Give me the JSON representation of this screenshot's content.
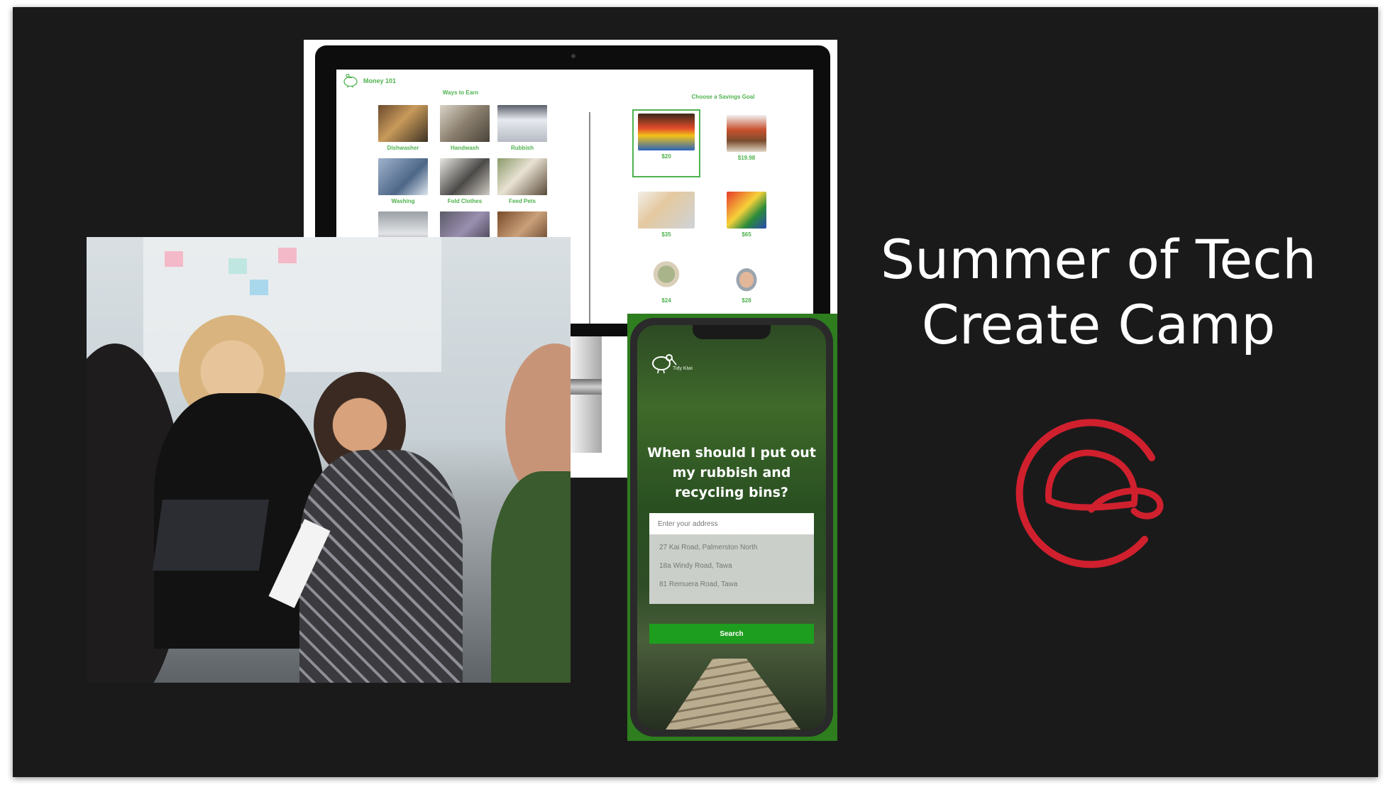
{
  "slide": {
    "title_line1": "Summer of Tech",
    "title_line2": "Create Camp",
    "logo_icon": "cap-circle-logo",
    "logo_color": "#d0202e",
    "background_color": "#1b1a1a"
  },
  "money_app": {
    "app_name": "Money 101",
    "earn_section_title": "Ways to Earn",
    "earn_items": [
      {
        "label": "Dishwasher"
      },
      {
        "label": "Handwash"
      },
      {
        "label": "Rubbish"
      },
      {
        "label": "Washing"
      },
      {
        "label": "Fold Clothes"
      },
      {
        "label": "Feed Pets"
      },
      {
        "label": ""
      },
      {
        "label": ""
      },
      {
        "label": ""
      }
    ],
    "goal_section_title": "Choose a Savings Goal",
    "goals": [
      {
        "price": "$20",
        "selected": true
      },
      {
        "price": "$19.98"
      },
      {
        "price": "$35"
      },
      {
        "price": "$65"
      },
      {
        "price": "$24"
      },
      {
        "price": "$28"
      }
    ],
    "accent_color": "#4fb24f"
  },
  "phone_app": {
    "brand": "Tidy Kiwi",
    "heading": "When should I put out my rubbish and recycling bins?",
    "address_placeholder": "Enter your address",
    "suggestions": [
      "27 Kai Road, Palmerston North",
      "18a Windy Road, Tawa",
      "81 Remuera Road, Tawa"
    ],
    "search_label": "Search",
    "accent_color": "#1e9e1e"
  }
}
